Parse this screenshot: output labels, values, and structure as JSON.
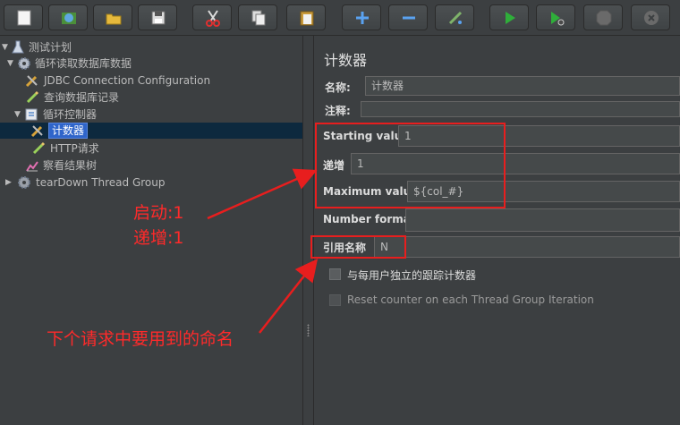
{
  "toolbar": {
    "buttons": [
      {
        "name": "new",
        "icon": "new-file-icon"
      },
      {
        "name": "templates",
        "icon": "templates-icon"
      },
      {
        "name": "open",
        "icon": "open-folder-icon"
      },
      {
        "name": "save",
        "icon": "save-icon"
      },
      {
        "name": "cut",
        "icon": "cut-icon"
      },
      {
        "name": "copy",
        "icon": "copy-icon"
      },
      {
        "name": "paste",
        "icon": "paste-icon"
      },
      {
        "name": "expand",
        "icon": "plus-icon"
      },
      {
        "name": "collapse",
        "icon": "minus-icon"
      },
      {
        "name": "toggle",
        "icon": "toggle-icon"
      },
      {
        "name": "start",
        "icon": "play-icon"
      },
      {
        "name": "start-no-pause",
        "icon": "play-no-pause-icon"
      },
      {
        "name": "stop",
        "icon": "stop-icon"
      },
      {
        "name": "shutdown",
        "icon": "shutdown-icon"
      }
    ]
  },
  "tree": {
    "test_plan": "测试计划",
    "loop_db": "循环读取数据库数据",
    "jdbc_config": "JDBC Connection Configuration",
    "query_db": "查询数据库记录",
    "loop_controller": "循环控制器",
    "counter": "计数器",
    "http_request": "HTTP请求",
    "results_tree": "察看结果树",
    "teardown": "tearDown Thread Group"
  },
  "panel": {
    "title": "计数器",
    "name_label": "名称:",
    "name_value": "计数器",
    "comment_label": "注释:",
    "comment_value": "",
    "starting_label": "Starting value",
    "starting_value": "1",
    "increment_label": "递增",
    "increment_value": "1",
    "maximum_label": "Maximum value",
    "maximum_value": "${col_#}",
    "format_label": "Number format",
    "format_value": "",
    "ref_label": "引用名称",
    "ref_value": "N",
    "check_independent": "与每用户独立的跟踪计数器",
    "check_reset": "Reset counter on each Thread Group Iteration"
  },
  "annotations": {
    "start_note": "启动:1",
    "increment_note": "递增:1",
    "name_note": "下个请求中要用到的命名"
  },
  "colors": {
    "background": "#3c3f41",
    "annotation": "#e81e1e",
    "selection": "#2f65ca"
  }
}
